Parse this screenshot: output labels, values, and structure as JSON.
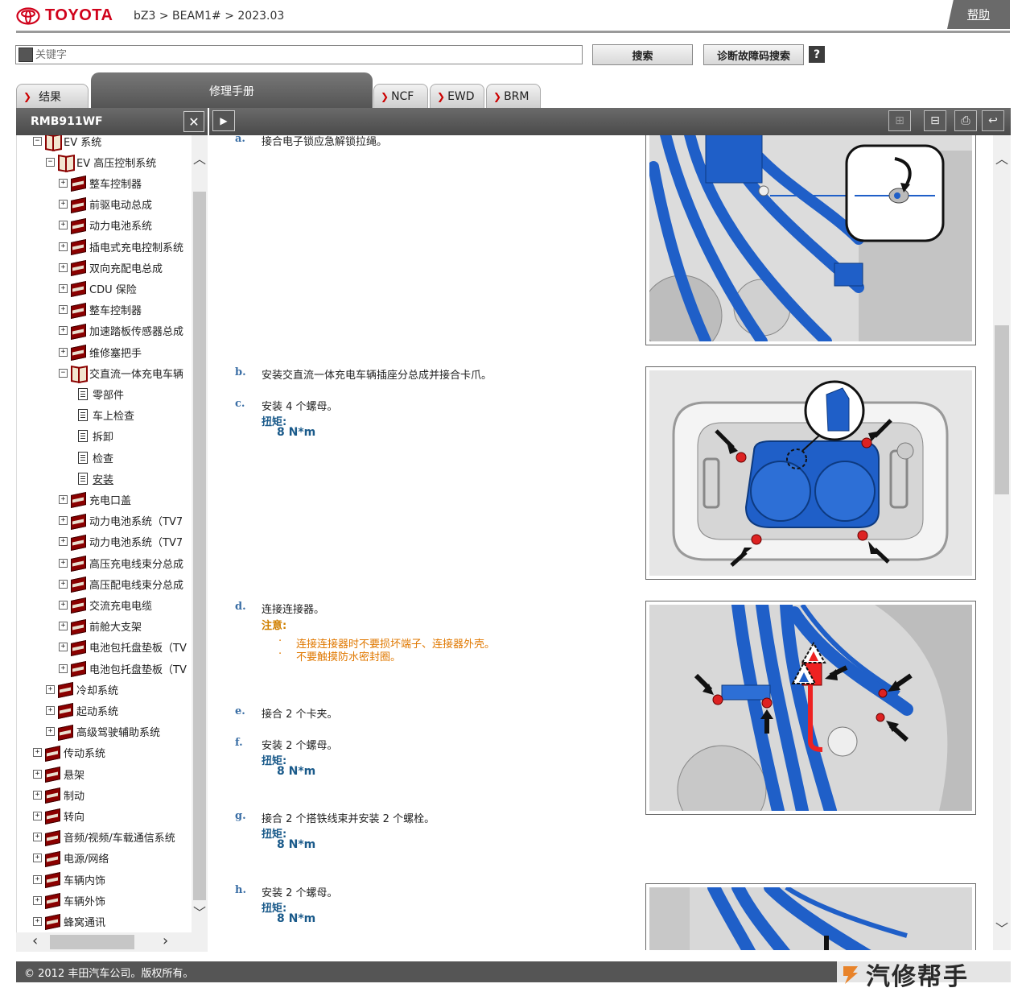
{
  "header": {
    "logo_text": "TOYOTA",
    "breadcrumb": "bZ3 > BEAM1# > 2023.03",
    "help_label": "帮助"
  },
  "search": {
    "placeholder": "关键字",
    "search_button": "搜索",
    "dtc_button": "诊断故障码搜索",
    "help_button": "?"
  },
  "tabs": {
    "results": "结果",
    "repair_manual": "修理手册",
    "ncf": "NCF",
    "ewd": "EWD",
    "brm": "BRM"
  },
  "sidebar": {
    "title": "RMB911WF",
    "tree": [
      {
        "label": "EV 系统",
        "level": 1,
        "icon": "open-book",
        "expander": "−"
      },
      {
        "label": "EV 高压控制系统",
        "level": 2,
        "icon": "open-book",
        "expander": "−"
      },
      {
        "label": "整车控制器",
        "level": 3,
        "icon": "closed-book",
        "expander": "+"
      },
      {
        "label": "前驱电动总成",
        "level": 3,
        "icon": "closed-book",
        "expander": "+"
      },
      {
        "label": "动力电池系统",
        "level": 3,
        "icon": "closed-book",
        "expander": "+"
      },
      {
        "label": "插电式充电控制系统",
        "level": 3,
        "icon": "closed-book",
        "expander": "+"
      },
      {
        "label": "双向充配电总成",
        "level": 3,
        "icon": "closed-book",
        "expander": "+"
      },
      {
        "label": "CDU 保险",
        "level": 3,
        "icon": "closed-book",
        "expander": "+"
      },
      {
        "label": "整车控制器",
        "level": 3,
        "icon": "closed-book",
        "expander": "+"
      },
      {
        "label": "加速踏板传感器总成",
        "level": 3,
        "icon": "closed-book",
        "expander": "+"
      },
      {
        "label": "维修塞把手",
        "level": 3,
        "icon": "closed-book",
        "expander": "+"
      },
      {
        "label": "交直流一体充电车辆",
        "level": 3,
        "icon": "open-book",
        "expander": "−"
      },
      {
        "label": "零部件",
        "level": 4,
        "icon": "document",
        "expander": ""
      },
      {
        "label": "车上检查",
        "level": 4,
        "icon": "document",
        "expander": ""
      },
      {
        "label": "拆卸",
        "level": 4,
        "icon": "document",
        "expander": ""
      },
      {
        "label": "检查",
        "level": 4,
        "icon": "document",
        "expander": ""
      },
      {
        "label": "安装",
        "level": 4,
        "icon": "document",
        "expander": "",
        "selected": true
      },
      {
        "label": "充电口盖",
        "level": 3,
        "icon": "closed-book",
        "expander": "+"
      },
      {
        "label": "动力电池系统（TV7",
        "level": 3,
        "icon": "closed-book",
        "expander": "+"
      },
      {
        "label": "动力电池系统（TV7",
        "level": 3,
        "icon": "closed-book",
        "expander": "+"
      },
      {
        "label": "高压充电线束分总成",
        "level": 3,
        "icon": "closed-book",
        "expander": "+"
      },
      {
        "label": "高压配电线束分总成",
        "level": 3,
        "icon": "closed-book",
        "expander": "+"
      },
      {
        "label": "交流充电电缆",
        "level": 3,
        "icon": "closed-book",
        "expander": "+"
      },
      {
        "label": "前舱大支架",
        "level": 3,
        "icon": "closed-book",
        "expander": "+"
      },
      {
        "label": "电池包托盘垫板（TV",
        "level": 3,
        "icon": "closed-book",
        "expander": "+"
      },
      {
        "label": "电池包托盘垫板（TV",
        "level": 3,
        "icon": "closed-book",
        "expander": "+"
      },
      {
        "label": "冷却系统",
        "level": 2,
        "icon": "closed-book",
        "expander": "+"
      },
      {
        "label": "起动系统",
        "level": 2,
        "icon": "closed-book",
        "expander": "+"
      },
      {
        "label": "高级驾驶辅助系统",
        "level": 2,
        "icon": "closed-book",
        "expander": "+"
      },
      {
        "label": "传动系统",
        "level": 1,
        "icon": "closed-book",
        "expander": "+"
      },
      {
        "label": "悬架",
        "level": 1,
        "icon": "closed-book",
        "expander": "+"
      },
      {
        "label": "制动",
        "level": 1,
        "icon": "closed-book",
        "expander": "+"
      },
      {
        "label": "转向",
        "level": 1,
        "icon": "closed-book",
        "expander": "+"
      },
      {
        "label": "音频/视频/车载通信系统",
        "level": 1,
        "icon": "closed-book",
        "expander": "+"
      },
      {
        "label": "电源/网络",
        "level": 1,
        "icon": "closed-book",
        "expander": "+"
      },
      {
        "label": "车辆内饰",
        "level": 1,
        "icon": "closed-book",
        "expander": "+"
      },
      {
        "label": "车辆外饰",
        "level": 1,
        "icon": "closed-book",
        "expander": "+"
      },
      {
        "label": "蜂窝通讯",
        "level": 1,
        "icon": "closed-book",
        "expander": "+"
      }
    ]
  },
  "content": {
    "steps": {
      "a": {
        "letter": "a.",
        "text": "接合电子锁应急解锁拉绳。"
      },
      "b": {
        "letter": "b.",
        "text": "安装交直流一体充电车辆插座分总成并接合卡爪。"
      },
      "c": {
        "letter": "c.",
        "text": "安装 4 个螺母。",
        "torque_label": "扭矩:",
        "torque_value": "8 N*m"
      },
      "d": {
        "letter": "d.",
        "text": "连接连接器。",
        "caution_label": "注意:",
        "cautions": [
          "连接连接器时不要损坏端子、连接器外壳。",
          "不要触摸防水密封圈。"
        ],
        "bullet": "·"
      },
      "e": {
        "letter": "e.",
        "text": "接合 2 个卡夹。"
      },
      "f": {
        "letter": "f.",
        "text": "安装 2 个螺母。",
        "torque_label": "扭矩:",
        "torque_value": "8 N*m"
      },
      "g": {
        "letter": "g.",
        "text": "接合 2 个搭铁线束并安装 2 个螺栓。",
        "torque_label": "扭矩:",
        "torque_value": "8 N*m"
      },
      "h": {
        "letter": "h.",
        "text": "安装 2 个螺母。",
        "torque_label": "扭矩:",
        "torque_value": "8 N*m"
      }
    }
  },
  "footer": {
    "copyright": "© 2012 丰田汽车公司。版权所有。",
    "watermark": "汽修帮手"
  },
  "colors": {
    "toyota_red": "#d0021b",
    "step_letter": "#3a6ea5",
    "torque": "#1a5a8a",
    "caution": "#e07800",
    "harness_blue": "#1f5fc8"
  }
}
